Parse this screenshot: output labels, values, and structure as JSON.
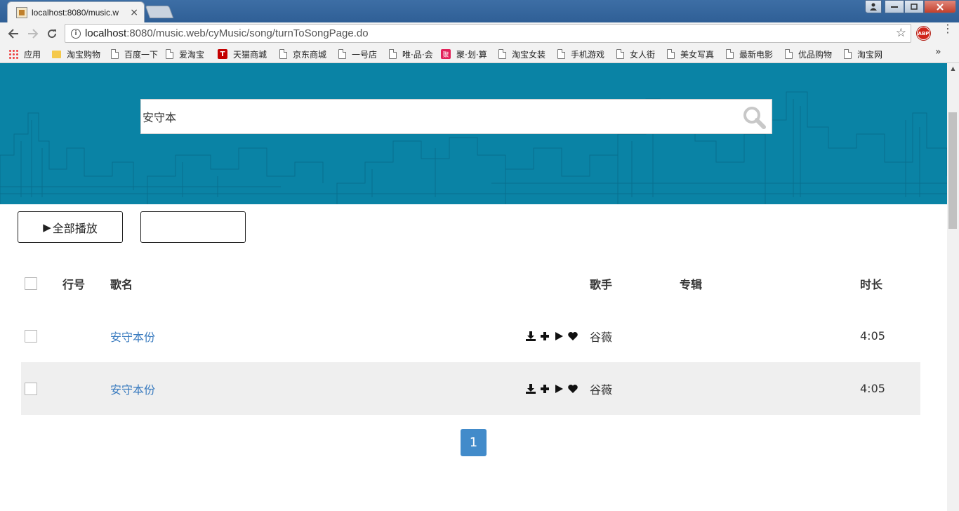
{
  "browser": {
    "tab_title": "localhost:8080/music.w",
    "tab_close": "×",
    "url_host": "localhost",
    "url_path": ":8080/music.web/cyMusic/song/turnToSongPage.do",
    "abp_label": "ABP"
  },
  "bookmarks": [
    {
      "label": "应用",
      "icon": "apps-grid-icon"
    },
    {
      "label": "淘宝购物",
      "icon": "folder-icon"
    },
    {
      "label": "百度一下",
      "icon": "page-icon"
    },
    {
      "label": "爱淘宝",
      "icon": "page-icon"
    },
    {
      "label": "天猫商城",
      "icon": "tmall-icon"
    },
    {
      "label": "京东商城",
      "icon": "page-icon"
    },
    {
      "label": "一号店",
      "icon": "page-icon"
    },
    {
      "label": "唯·品·会",
      "icon": "page-icon"
    },
    {
      "label": "聚·划·算",
      "icon": "juhuasuan-icon"
    },
    {
      "label": "淘宝女装",
      "icon": "page-icon"
    },
    {
      "label": "手机游戏",
      "icon": "page-icon"
    },
    {
      "label": "女人街",
      "icon": "page-icon"
    },
    {
      "label": "美女写真",
      "icon": "page-icon"
    },
    {
      "label": "最新电影",
      "icon": "page-icon"
    },
    {
      "label": "优品购物",
      "icon": "page-icon"
    },
    {
      "label": "淘宝网",
      "icon": "page-icon"
    }
  ],
  "bookmark_icons": {
    "tmall": "T",
    "ju": "聚"
  },
  "search": {
    "value": "安守本"
  },
  "buttons": {
    "play_all_icon": "▶",
    "play_all": "全部播放",
    "second": ""
  },
  "table": {
    "headers": {
      "no": "行号",
      "name": "歌名",
      "singer": "歌手",
      "album": "专辑",
      "duration": "时长"
    },
    "rows": [
      {
        "no": "",
        "name": "安守本份",
        "singer": "谷薇",
        "album": "",
        "duration": "4:05"
      },
      {
        "no": "",
        "name": "安守本份",
        "singer": "谷薇",
        "album": "",
        "duration": "4:05"
      }
    ]
  },
  "pagination": {
    "current": "1"
  },
  "colors": {
    "hero": "#0a83a5",
    "link": "#3a7bbf",
    "pager": "#428bca",
    "alt_row": "#efefef"
  }
}
